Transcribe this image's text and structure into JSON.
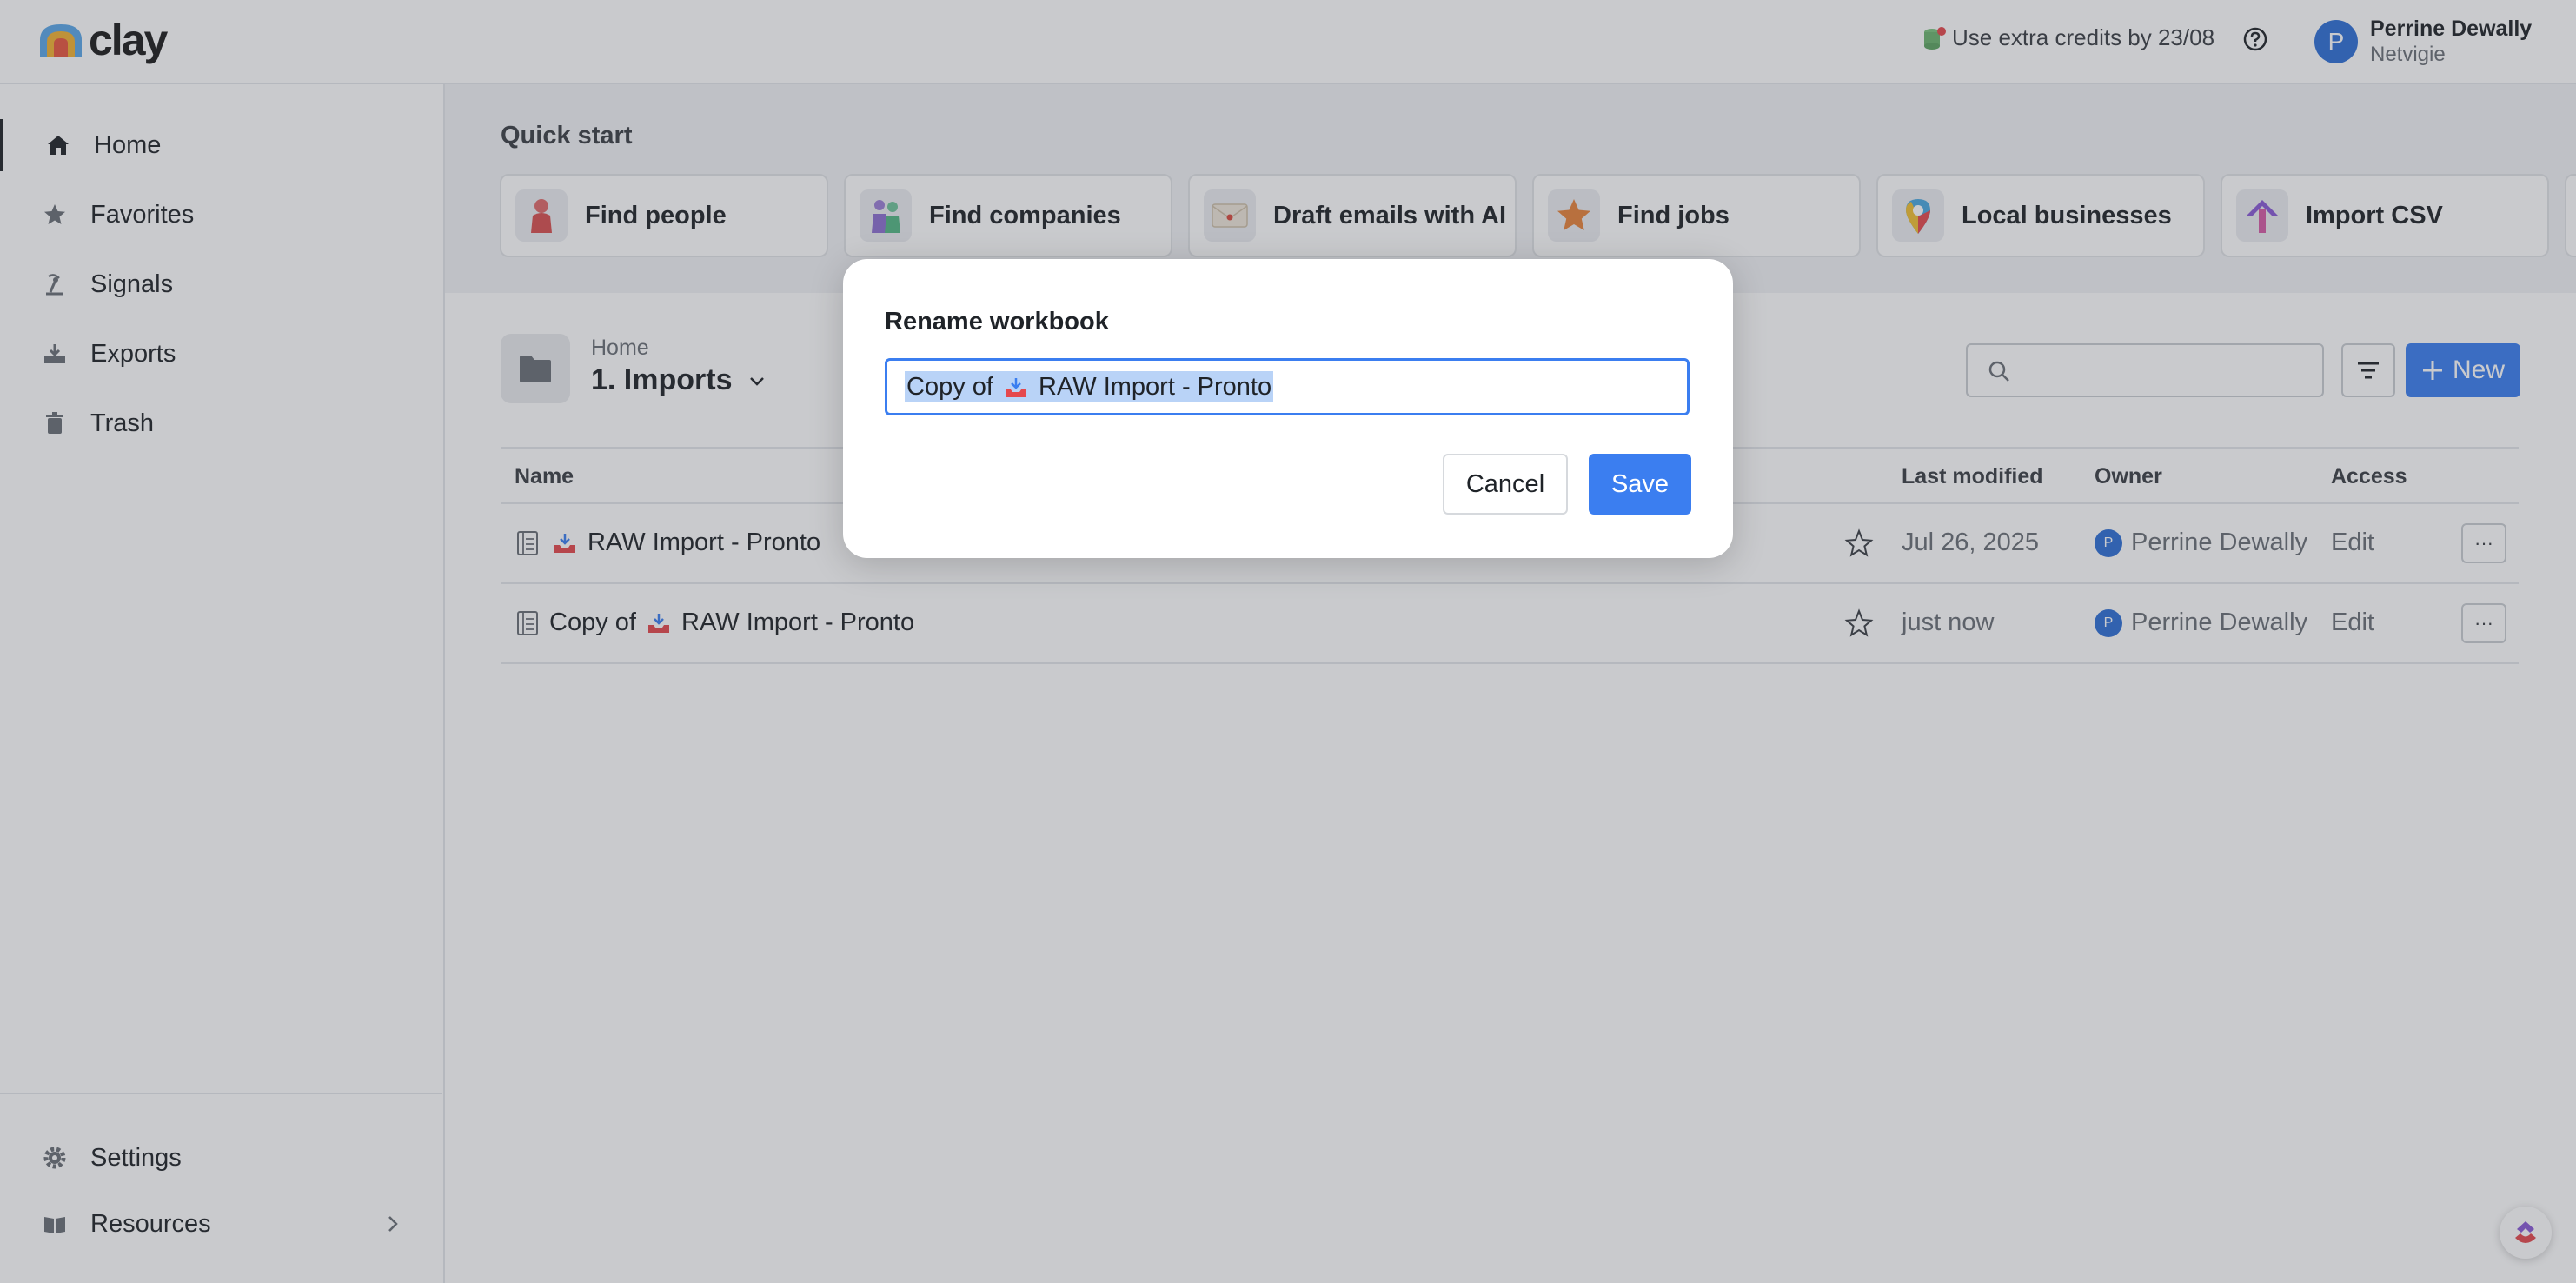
{
  "app": {
    "logo_text": "clay",
    "credits_text": "Use extra credits by 23/08",
    "user": {
      "initial": "P",
      "name": "Perrine Dewally",
      "org": "Netvigie"
    }
  },
  "sidebar": {
    "items": [
      {
        "label": "Home",
        "icon": "home-icon",
        "active": true
      },
      {
        "label": "Favorites",
        "icon": "star-icon"
      },
      {
        "label": "Signals",
        "icon": "signal-icon"
      },
      {
        "label": "Exports",
        "icon": "export-icon"
      },
      {
        "label": "Trash",
        "icon": "trash-icon"
      }
    ],
    "bottom": [
      {
        "label": "Settings",
        "icon": "gear-icon"
      },
      {
        "label": "Resources",
        "icon": "book-icon"
      }
    ]
  },
  "quick_start": {
    "title": "Quick start",
    "cards": [
      {
        "label": "Find people",
        "icon": "person-icon"
      },
      {
        "label": "Find companies",
        "icon": "group-icon"
      },
      {
        "label": "Draft emails with AI",
        "icon": "envelope-icon"
      },
      {
        "label": "Find jobs",
        "icon": "star-badge-icon"
      },
      {
        "label": "Local businesses",
        "icon": "map-pin-icon"
      },
      {
        "label": "Import CSV",
        "icon": "arrow-up-icon"
      }
    ]
  },
  "folder": {
    "breadcrumb_home": "Home",
    "name": "1. Imports"
  },
  "toolbar": {
    "search_placeholder": "",
    "new_label": "New"
  },
  "table": {
    "headers": {
      "name": "Name",
      "modified": "Last modified",
      "owner": "Owner",
      "access": "Access"
    },
    "rows": [
      {
        "name_prefix": "",
        "name_suffix": "RAW Import - Pronto",
        "modified": "Jul 26, 2025",
        "owner_initial": "P",
        "owner": "Perrine Dewally",
        "access": "Edit",
        "more": "···"
      },
      {
        "name_prefix": "Copy of",
        "name_suffix": "RAW Import - Pronto",
        "modified": "just now",
        "owner_initial": "P",
        "owner": "Perrine Dewally",
        "access": "Edit",
        "more": "···"
      }
    ]
  },
  "modal": {
    "title": "Rename workbook",
    "value_prefix": "Copy of",
    "value_suffix": "RAW Import - Pronto",
    "cancel_label": "Cancel",
    "save_label": "Save"
  },
  "colors": {
    "accent": "#3b7ef0",
    "avatar": "#2e6fd6",
    "selection": "#b9d3f7"
  }
}
